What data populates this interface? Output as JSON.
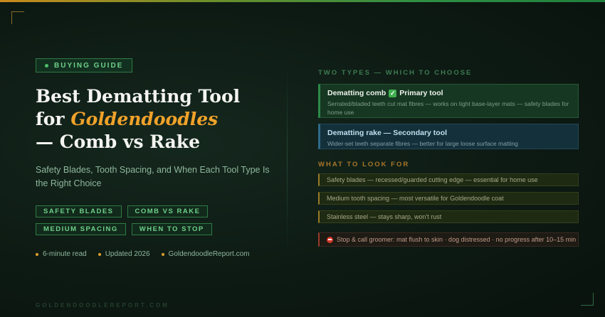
{
  "badge": {
    "label": "BUYING GUIDE"
  },
  "title": {
    "line1": "Best Dematting Tool",
    "line2_prefix": "for ",
    "line2_accent": "Goldendoodles",
    "line3": "— Comb vs Rake"
  },
  "subtitle": "Safety Blades, Tooth Spacing, and When Each Tool Type Is the Right Choice",
  "tags": {
    "row1": [
      "SAFETY BLADES",
      "COMB VS RAKE"
    ],
    "row2": [
      "MEDIUM SPACING",
      "WHEN TO STOP"
    ]
  },
  "meta": [
    "6-minute read",
    "Updated 2026",
    "GoldendoodleReport.com"
  ],
  "footer_site": "GOLDENDOODLEREPORT.COM",
  "types": {
    "heading": "TWO TYPES — WHICH TO CHOOSE",
    "primary": {
      "title_prefix": "Dematting comb",
      "title_suffix": "Primary tool",
      "desc": "Serrated/bladed teeth cut mat fibres — works on tight base-layer mats — safety blades for home use"
    },
    "secondary": {
      "title": "Dematting rake — Secondary tool",
      "desc": "Wider-set teeth separate fibres — better for large loose surface matting"
    }
  },
  "look_for": {
    "heading": "WHAT TO LOOK FOR",
    "items": [
      "Safety blades — recessed/guarded cutting edge — essential for home use",
      "Medium tooth spacing — most versatile for Goldendoodle coat",
      "Stainless steel — stays sharp, won't rust"
    ]
  },
  "stop": "Stop & call groomer: mat flush to skin · dog distressed · no progress after 10–15 min",
  "colors": {
    "accent_orange": "#f0a22a",
    "accent_green": "#6fd08a",
    "background": "#0d1a13"
  }
}
